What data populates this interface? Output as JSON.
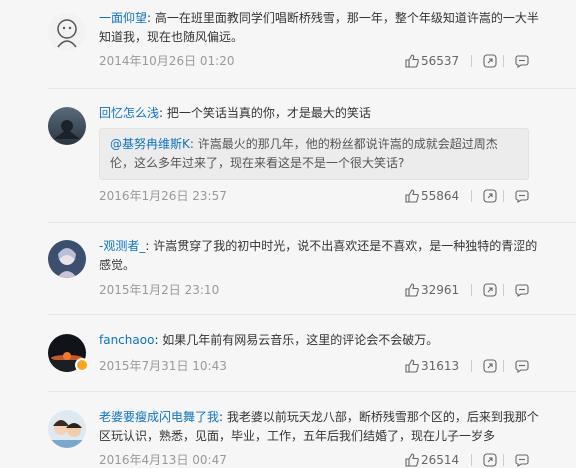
{
  "comments": [
    {
      "user": "一面仰望",
      "sep": ": ",
      "content": "高一在班里面教同学们唱断桥残雪，那一年，整个年级知道许嵩的一大半知道我，现在也随风偏远。",
      "time": "2014年10月26日 01:20",
      "likes": "56537"
    },
    {
      "user": "回忆怎么浅",
      "sep": ": ",
      "content": "把一个笑话当真的你，才是最大的笑话",
      "quote_user": "@基努冉维斯K",
      "quote_sep": ": ",
      "quote_content": "许嵩最火的那几年，他的粉丝都说许嵩的成就会超过周杰伦，这么多年过来了，现在来看这是不是一个很大笑话?",
      "time": "2016年1月26日 23:57",
      "likes": "55864"
    },
    {
      "user": "-观测者_",
      "sep": ": ",
      "content": "许嵩贯穿了我的初中时光，说不出喜欢还是不喜欢，是一种独特的青涩的感觉。",
      "time": "2015年1月2日 23:10",
      "likes": "32961"
    },
    {
      "user": "fanchaoo",
      "sep": ": ",
      "content": "如果几年前有网易云音乐，这里的评论会不会破万。",
      "time": "2015年7月31日 10:43",
      "likes": "31613"
    },
    {
      "user": "老婆要瘦成闪电舞了我",
      "sep": ": ",
      "content": "我老婆以前玩天龙八部，断桥残雪那个区的，后来到我那个区玩认识，熟悉，见面，毕业，工作，五年后我们结婚了，现在儿子一岁多",
      "time": "2016年4月13日 00:47",
      "likes": "26514"
    }
  ],
  "icons": {
    "like": "thumbs-up-icon",
    "share": "share-icon",
    "reply": "comment-icon"
  },
  "colors": {
    "username": "#0c73c2",
    "time": "#999999",
    "background": "#f6f6f6",
    "quote_bg": "#ececec"
  }
}
